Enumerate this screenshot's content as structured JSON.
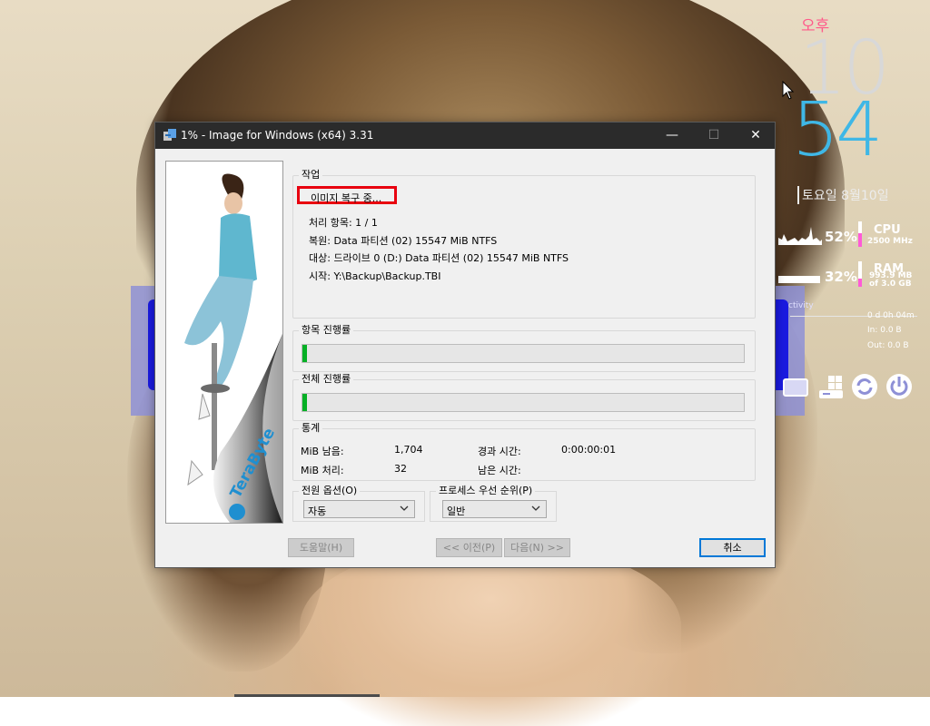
{
  "desktop": {
    "clock": {
      "ampm": "오후",
      "hour": "10",
      "minute": "54",
      "date": "토요일 8월10일"
    },
    "cpu": {
      "percent": "52%",
      "label": "CPU",
      "speed": "2500 MHz",
      "usage_fraction": 0.52
    },
    "ram": {
      "percent": "32%",
      "label": "RAM",
      "used": "993.9 MB",
      "total": "of  3.0 GB",
      "usage_fraction": 0.32
    },
    "network": {
      "title": "ctivity",
      "uptime": "0 d 0h 04m",
      "in": "In: 0.0 B",
      "out": "Out: 0.0 B"
    },
    "colors": {
      "accent_pink": "#ff5ad7",
      "minute_blue": "#3fb7e6"
    }
  },
  "window": {
    "title": "1% - Image for Windows (x64) 3.31",
    "controls": {
      "minimize": "—",
      "maximize": "☐",
      "close": "✕"
    }
  },
  "job": {
    "group_label": "작업",
    "status": "이미지 복구 중...",
    "items": "처리 항목: 1 / 1",
    "source": "복원: Data 파티션 (02) 15547 MiB NTFS",
    "target": "대상: 드라이브 0 (D:) Data 파티션 (02) 15547 MiB NTFS",
    "start": "시작: Y:\\Backup\\Backup.TBI"
  },
  "item_progress": {
    "label": "항목 진행률",
    "fraction": 0.01
  },
  "total_progress": {
    "label": "전체 진행률",
    "fraction": 0.01
  },
  "stats": {
    "label": "통계",
    "mib_remaining_label": "MiB 남음:",
    "mib_remaining_value": "1,704",
    "mib_processed_label": "MiB 처리:",
    "mib_processed_value": "32",
    "elapsed_label": "경과 시간:",
    "elapsed_value": "0:00:00:01",
    "remaining_label": "남은 시간:",
    "remaining_value": ""
  },
  "power": {
    "label": "전원 옵션(O)",
    "selected": "자동"
  },
  "priority": {
    "label": "프로세스 우선 순위(P)",
    "selected": "일반"
  },
  "buttons": {
    "help": "도움말(H)",
    "prev": "<< 이전(P)",
    "next": "다음(N) >>",
    "cancel": "취소"
  },
  "banner": {
    "brand": "TeraByte"
  }
}
